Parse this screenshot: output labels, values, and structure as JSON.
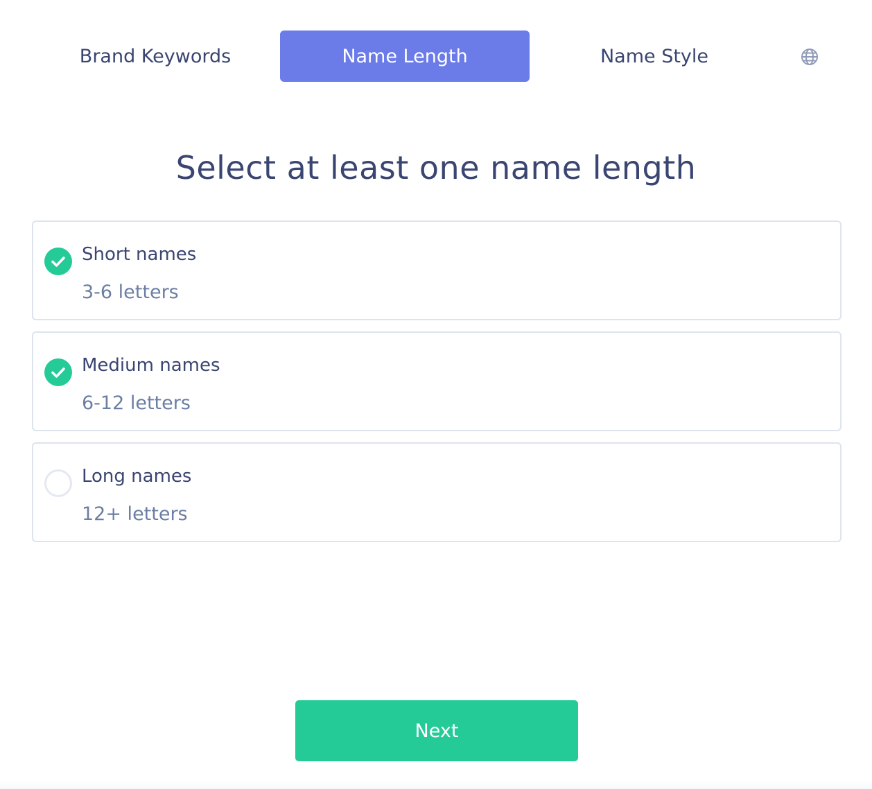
{
  "tabs": [
    {
      "label": "Brand Keywords",
      "active": false
    },
    {
      "label": "Name Length",
      "active": true
    },
    {
      "label": "Name Style",
      "active": false
    }
  ],
  "language_icon": "globe-icon",
  "heading": "Select at least one name length",
  "options": [
    {
      "title": "Short names",
      "subtitle": "3-6 letters",
      "checked": true
    },
    {
      "title": "Medium names",
      "subtitle": "6-12 letters",
      "checked": true
    },
    {
      "title": "Long names",
      "subtitle": "12+ letters",
      "checked": false
    }
  ],
  "next_label": "Next",
  "colors": {
    "accent_tab": "#6b7be8",
    "primary_green": "#24cb97",
    "text_dark": "#3a4571",
    "text_muted": "#6b7ea3"
  }
}
